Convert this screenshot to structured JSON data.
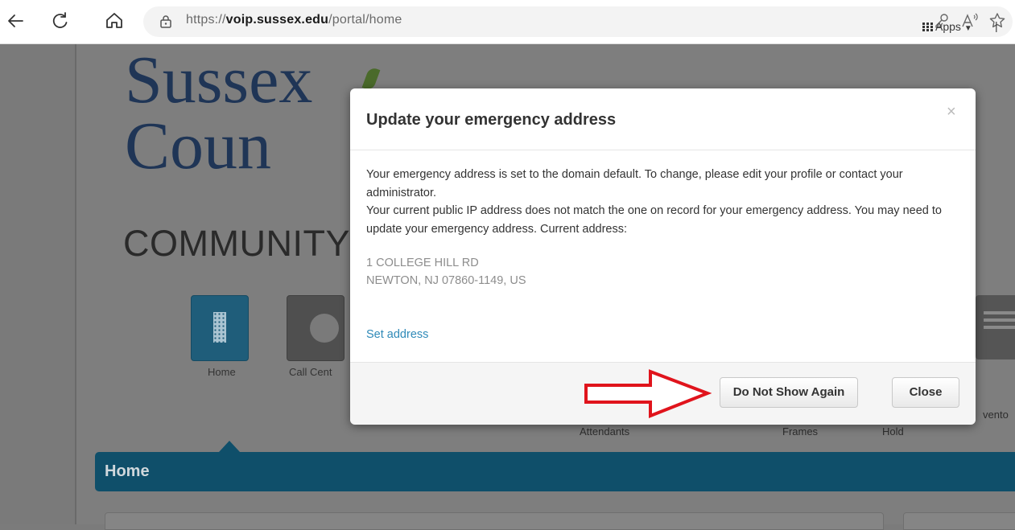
{
  "browser": {
    "url_scheme": "https://",
    "url_domain": "voip.sussex.edu",
    "url_path": "/portal/home"
  },
  "page": {
    "apps_label": "Apps",
    "apps_separator": "|",
    "logo_line1": "Sussex",
    "logo_line2": "Coun",
    "logo_sub": "COMMUNITY C",
    "nav_tiles": [
      {
        "label": "Home"
      },
      {
        "label": "Call Cent"
      }
    ],
    "under_labels": {
      "attendants": "Attendants",
      "frames": "Frames",
      "hold": "Hold",
      "invento": "vento"
    },
    "section_title": "Home"
  },
  "modal": {
    "title": "Update your emergency address",
    "close_symbol": "×",
    "line1": "Your emergency address is set to the domain default. To change, please edit your profile or contact your administrator.",
    "line2": "Your current public IP address does not match the one on record for your emergency address. You may need to update your emergency address. Current address:",
    "address_line1": "1 COLLEGE HILL RD",
    "address_line2": "NEWTON, NJ 07860-1149, US",
    "set_address_link": "Set address",
    "do_not_show_label": "Do Not Show Again",
    "close_label": "Close"
  },
  "colors": {
    "accent_blue": "#0f4f6a",
    "link_blue": "#2f8ab8",
    "annotation_red": "#e0141c"
  }
}
